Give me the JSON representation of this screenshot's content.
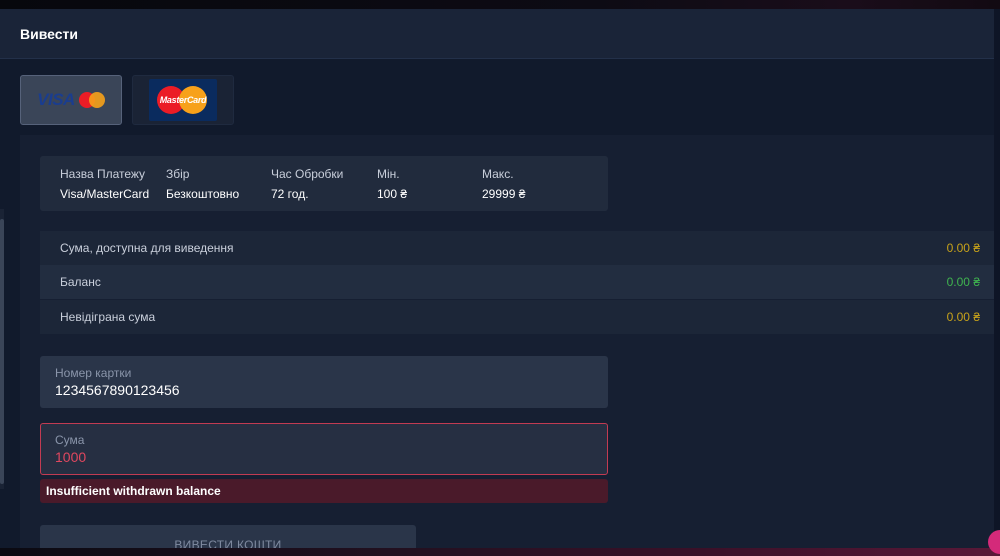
{
  "header": {
    "title": "Вивести"
  },
  "methods": [
    {
      "name": "Visa/MasterCard",
      "logo_text": "VISA",
      "active": true
    },
    {
      "name": "MasterCard",
      "logo_text": "MasterCard",
      "active": false
    }
  ],
  "info": {
    "columns": [
      {
        "header": "Назва Платежу",
        "value": "Visa/MasterCard"
      },
      {
        "header": "Збір",
        "value": "Безкоштовно"
      },
      {
        "header": "Час Обробки",
        "value": "72 год."
      },
      {
        "header": "Мін.",
        "value": "100 ₴"
      },
      {
        "header": "Макс.",
        "value": "29999 ₴"
      }
    ]
  },
  "balances": [
    {
      "label": "Сума, доступна для виведення",
      "amount": "0.00 ₴",
      "color": "#c7a21a"
    },
    {
      "label": "Баланс",
      "amount": "0.00 ₴",
      "color": "#3fb34f"
    },
    {
      "label": "Невідіграна сума",
      "amount": "0.00 ₴",
      "color": "#c7a21a"
    }
  ],
  "card_field": {
    "label": "Номер картки",
    "value": "1234567890123456"
  },
  "amount_field": {
    "label": "Сума",
    "value": "1000"
  },
  "error": {
    "message": "Insufficient withdrawn balance"
  },
  "submit": {
    "label": "ВИВЕСТИ КОШТИ"
  },
  "colors": {
    "accent_error": "#c23b52",
    "background": "#111a2c",
    "panel": "#161f32"
  }
}
